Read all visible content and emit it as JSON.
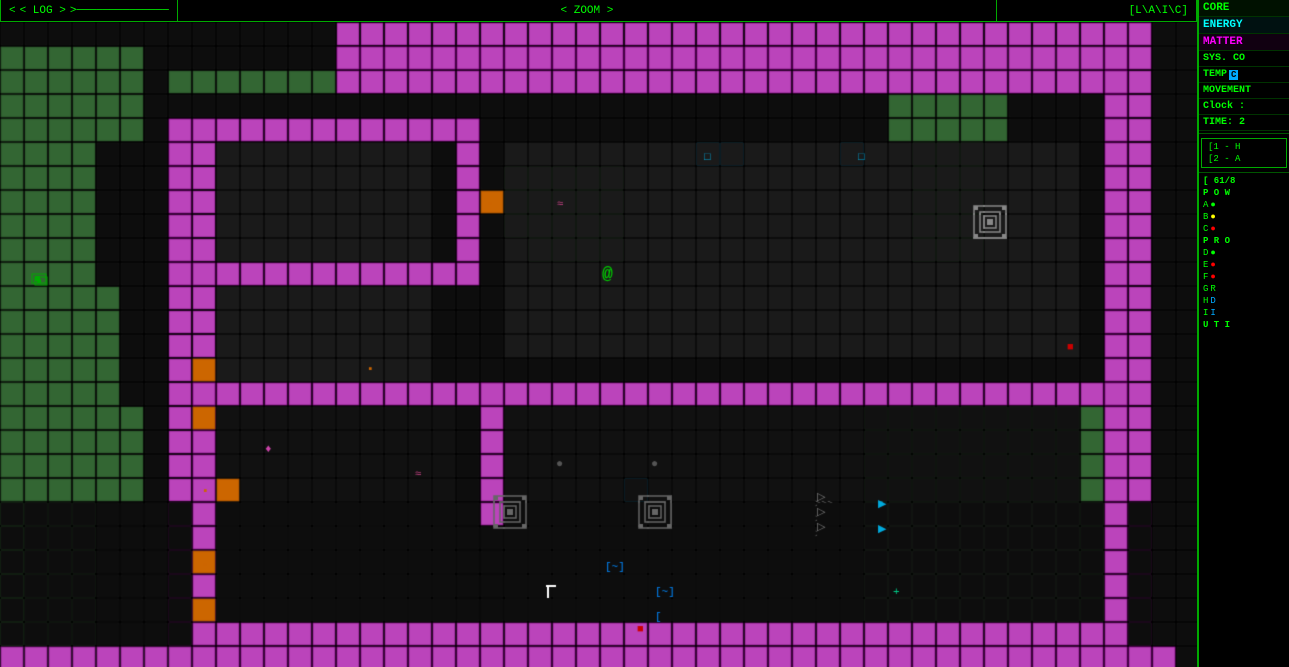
{
  "header": {
    "log_label": "< LOG >",
    "zoom_label": "< ZOOM >",
    "laic_label": "[L\\A\\I\\C]"
  },
  "right_panel": {
    "core_label": "CORE",
    "energy_label": "ENERGY",
    "matter_label": "MATTER",
    "sys_label": "SYS. CO",
    "temp_label": "TEMP",
    "temp_value": "C",
    "movement_label": "MOVEMENT",
    "clock_label": "Clock :",
    "time_label": "TIME: 2",
    "keybind1": "[1 - H",
    "keybind2": "[2 - A",
    "power_header": "[ 61/8",
    "pow_label": "P O W",
    "row_a_label": "A",
    "row_b_label": "B",
    "row_c_label": "C",
    "pro_label": "P R O",
    "row_d_label": "D",
    "row_e_label": "E",
    "row_f_label": "F",
    "row_g_label": "G",
    "row_h_label": "H",
    "row_i_label": "I",
    "uti_label": "U T I"
  },
  "map": {
    "background_color": "#000000",
    "tile_colors": {
      "purple": "#cc44cc",
      "green_dark": "#336633",
      "green_bright": "#00cc00",
      "gray": "#555555",
      "orange": "#cc6600",
      "dark_gray": "#222222",
      "cyan": "#00aacc",
      "teal": "#00cc88",
      "pink": "#cc44aa",
      "red": "#aa0000",
      "white_gray": "#888888"
    }
  }
}
